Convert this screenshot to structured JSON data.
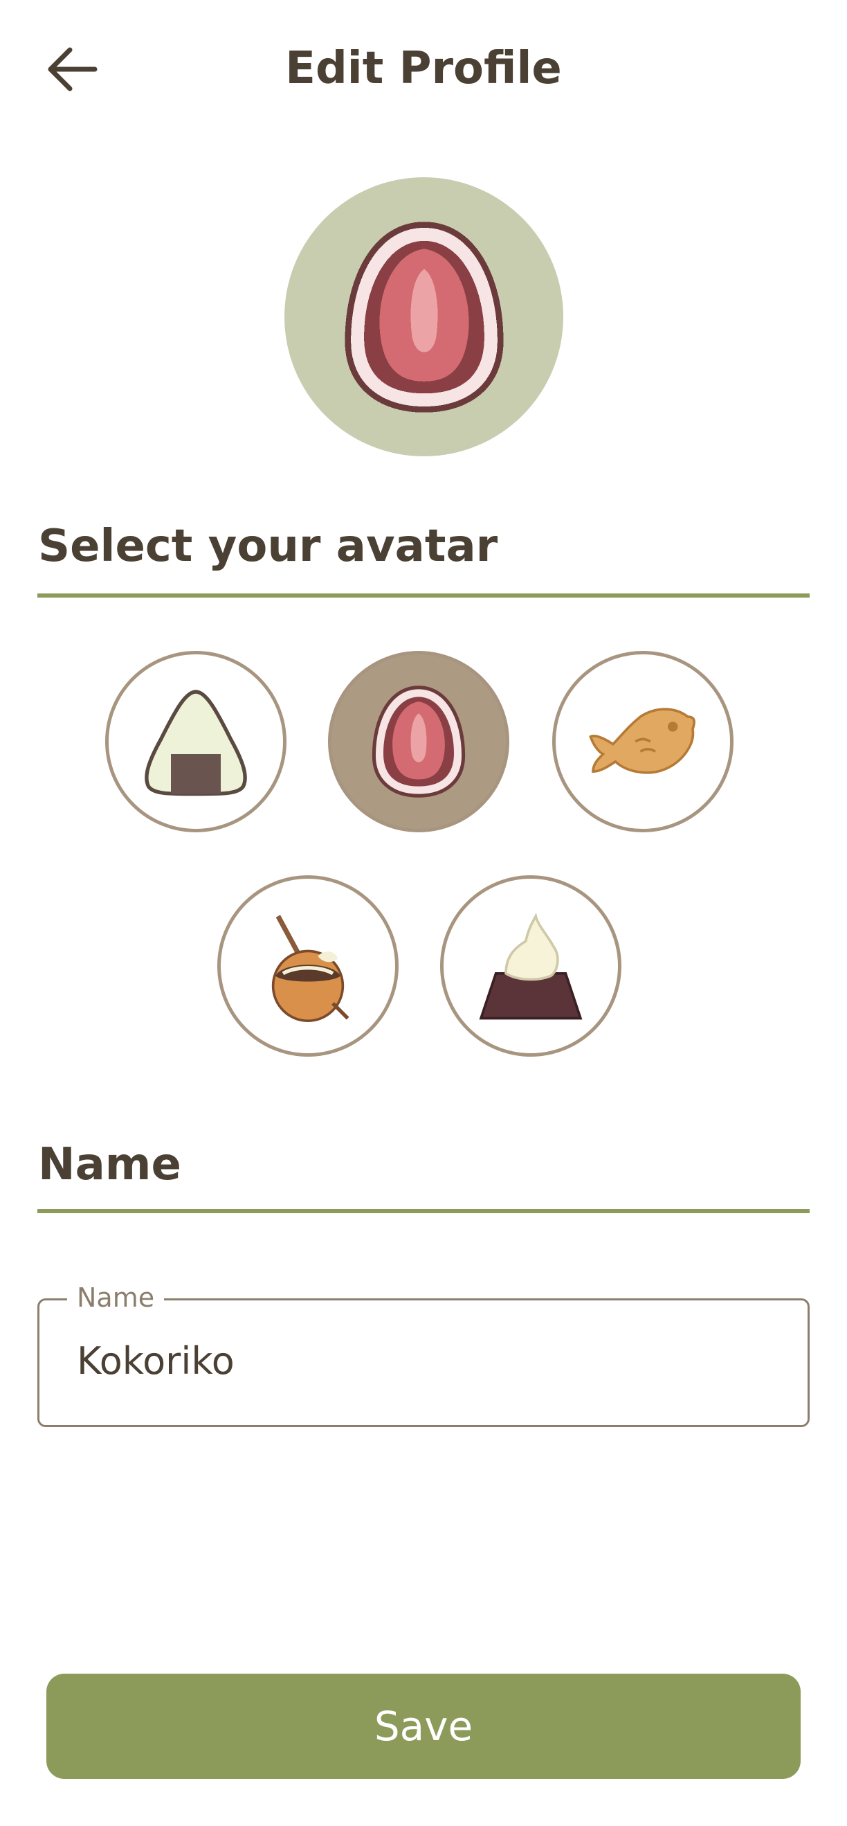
{
  "header": {
    "title": "Edit Profile",
    "back_icon": "arrow-left-icon"
  },
  "profile": {
    "current_avatar": "strawberry-mochi",
    "background_color": "#c8cdb0"
  },
  "avatar_section": {
    "heading": "Select your avatar",
    "options": [
      {
        "id": "onigiri",
        "selected": false
      },
      {
        "id": "strawberry-mochi",
        "selected": true
      },
      {
        "id": "taiyaki",
        "selected": false
      },
      {
        "id": "takoyaki",
        "selected": false
      },
      {
        "id": "chocolate-cake",
        "selected": false
      }
    ]
  },
  "name_section": {
    "heading": "Name",
    "field_label": "Name",
    "field_value": "Kokoriko"
  },
  "actions": {
    "save_label": "Save"
  },
  "colors": {
    "accent": "#8c9a5a",
    "text": "#4a4033",
    "selected_bg": "#ad9a83",
    "ring": "#a89580"
  }
}
